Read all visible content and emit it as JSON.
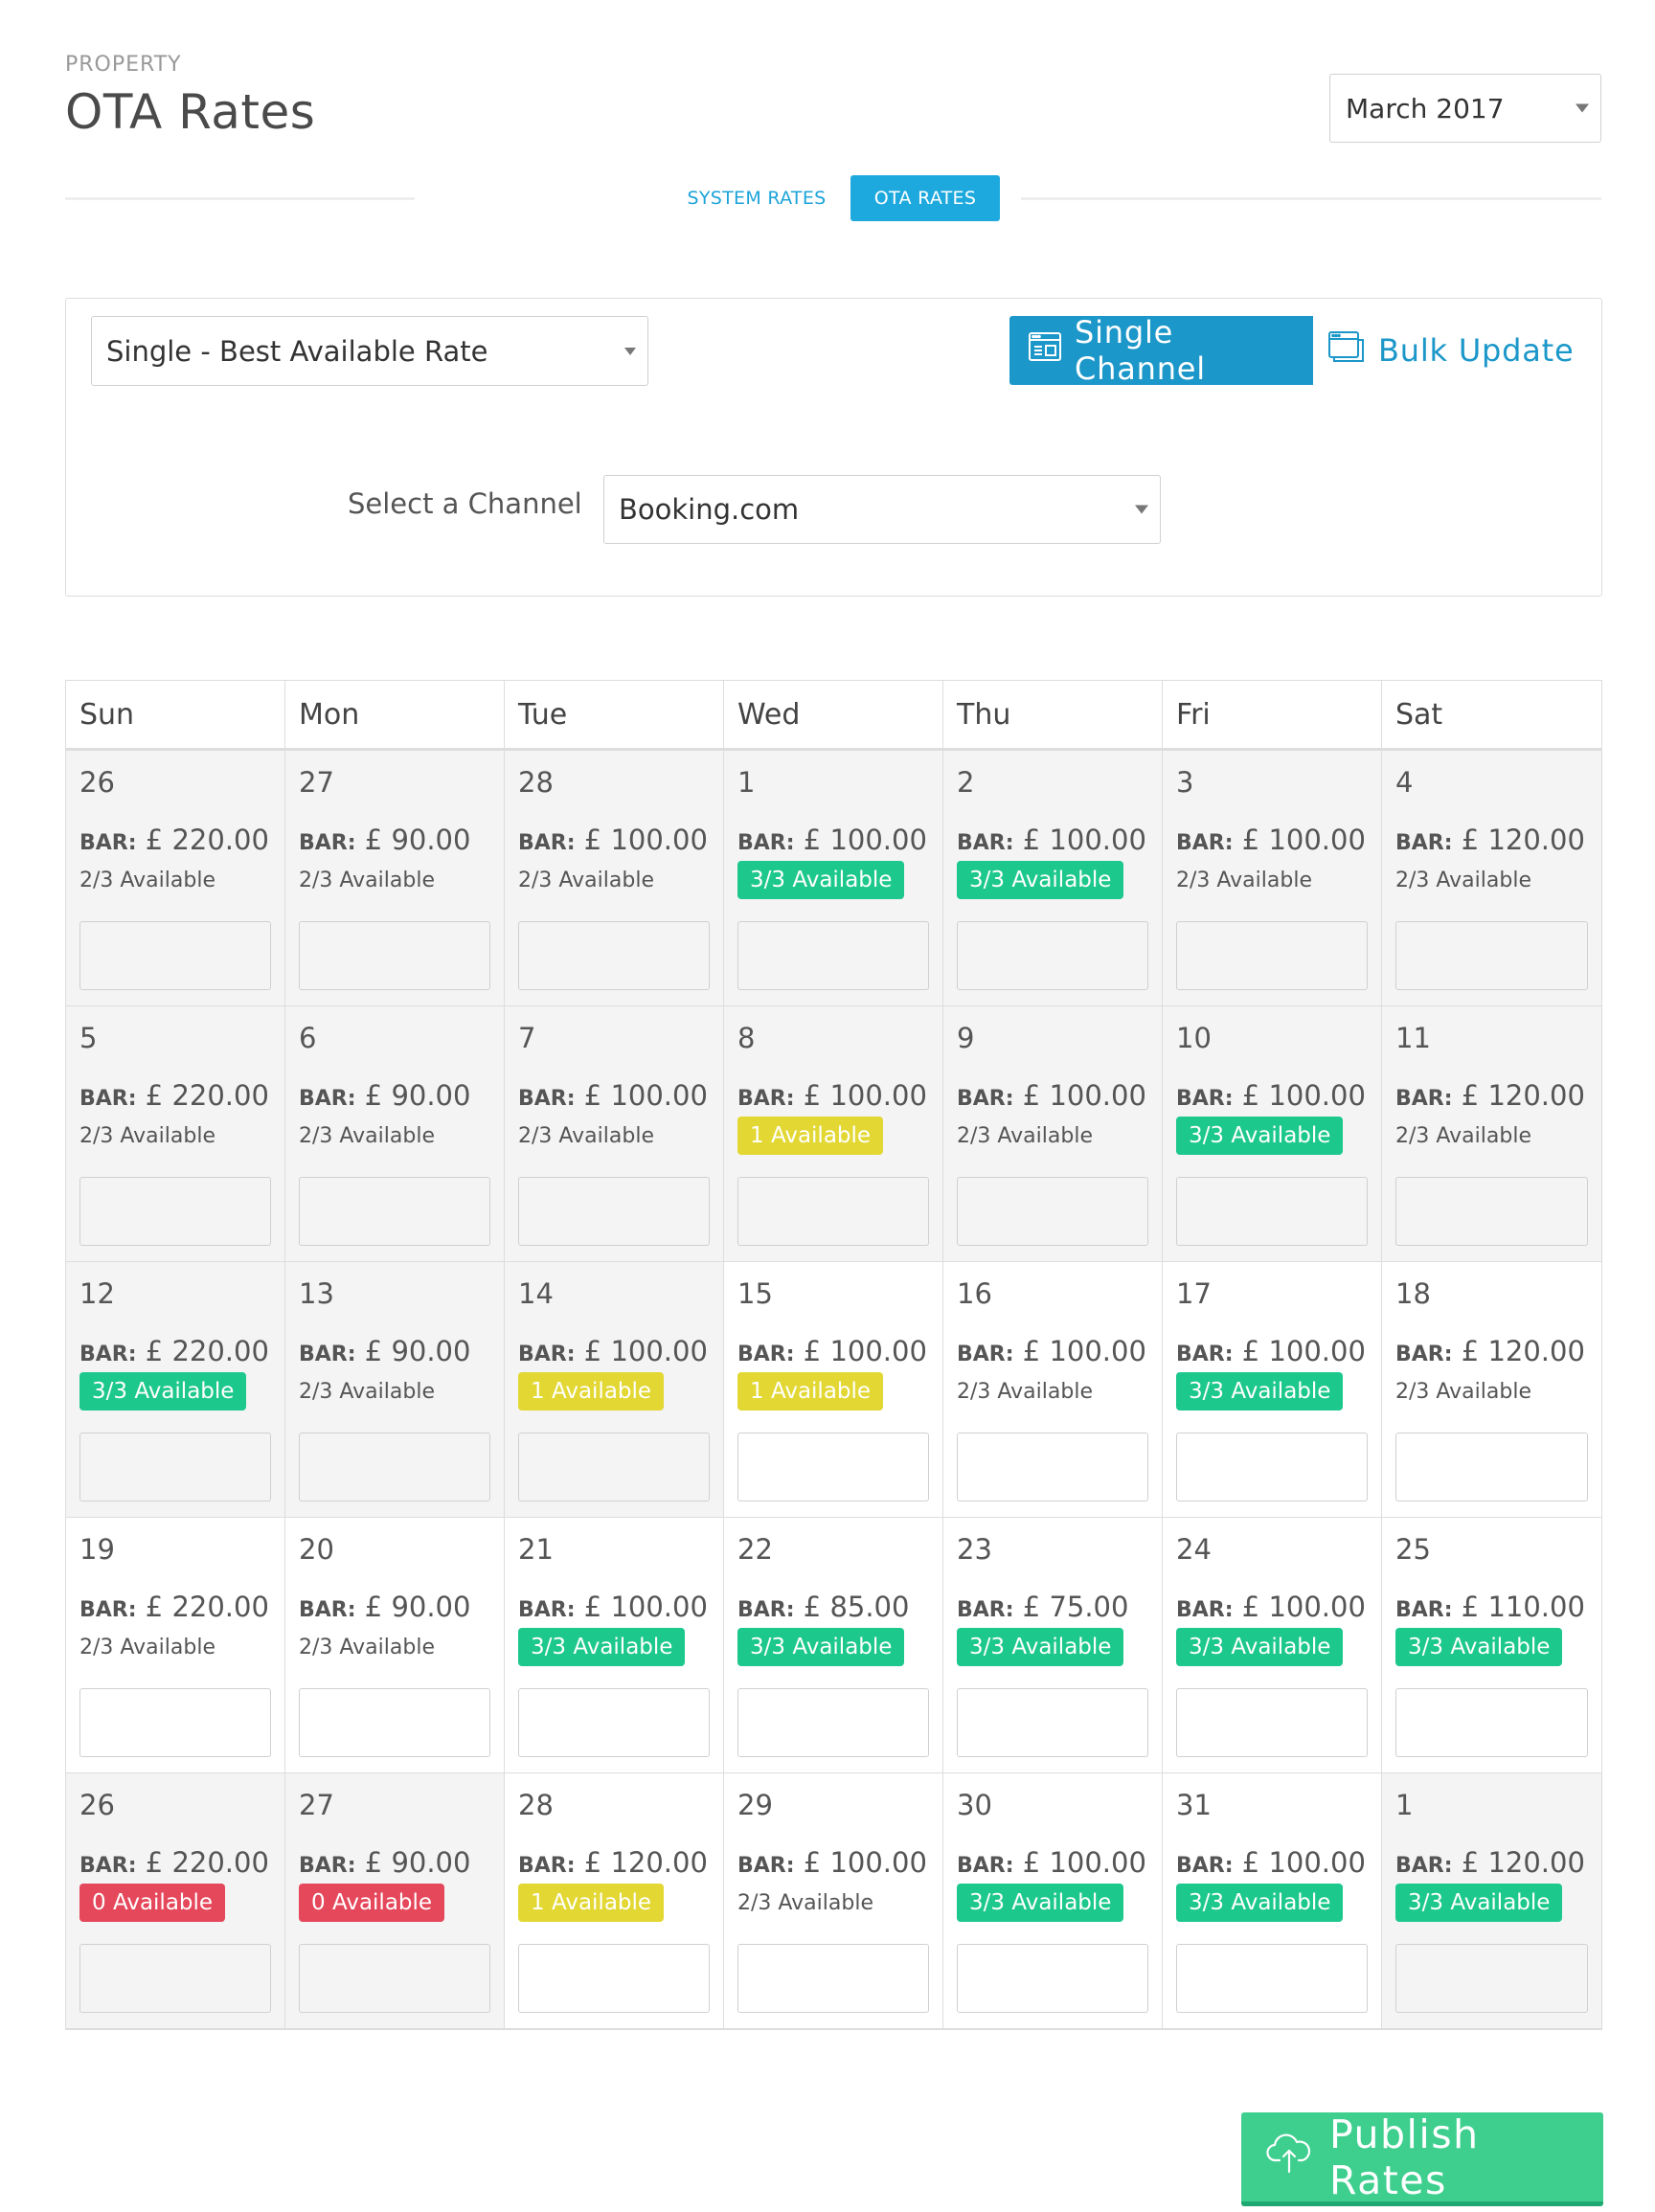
{
  "header": {
    "eyebrow": "PROPERTY",
    "title": "OTA Rates",
    "month_select": {
      "value": "March 2017",
      "icon": "chevron-down-icon"
    }
  },
  "tabs": [
    {
      "label": "SYSTEM RATES",
      "active": false
    },
    {
      "label": "OTA RATES",
      "active": true
    }
  ],
  "panel": {
    "rate_select": {
      "value": "Single - Best Available Rate"
    },
    "mode_buttons": [
      {
        "label": "Single Channel",
        "icon": "single-window-icon",
        "active": true
      },
      {
        "label": "Bulk Update",
        "icon": "stacked-windows-icon",
        "active": false
      }
    ],
    "channel_label": "Select a Channel",
    "channel_select": {
      "value": "Booking.com"
    }
  },
  "calendar": {
    "bar_label": "BAR:",
    "currency": "£",
    "weekdays": [
      "Sun",
      "Mon",
      "Tue",
      "Wed",
      "Thu",
      "Fri",
      "Sat"
    ],
    "days": [
      {
        "day": "26",
        "rate": "220.00",
        "availability": "2/3 Available",
        "status": "plain",
        "past": true
      },
      {
        "day": "27",
        "rate": "90.00",
        "availability": "2/3 Available",
        "status": "plain",
        "past": true
      },
      {
        "day": "28",
        "rate": "100.00",
        "availability": "2/3 Available",
        "status": "plain",
        "past": true
      },
      {
        "day": "1",
        "rate": "100.00",
        "availability": "3/3 Available",
        "status": "green",
        "past": true
      },
      {
        "day": "2",
        "rate": "100.00",
        "availability": "3/3 Available",
        "status": "green",
        "past": true
      },
      {
        "day": "3",
        "rate": "100.00",
        "availability": "2/3 Available",
        "status": "plain",
        "past": true
      },
      {
        "day": "4",
        "rate": "120.00",
        "availability": "2/3 Available",
        "status": "plain",
        "past": true
      },
      {
        "day": "5",
        "rate": "220.00",
        "availability": "2/3 Available",
        "status": "plain",
        "past": true
      },
      {
        "day": "6",
        "rate": "90.00",
        "availability": "2/3 Available",
        "status": "plain",
        "past": true
      },
      {
        "day": "7",
        "rate": "100.00",
        "availability": "2/3 Available",
        "status": "plain",
        "past": true
      },
      {
        "day": "8",
        "rate": "100.00",
        "availability": "1 Available",
        "status": "yellow",
        "past": true
      },
      {
        "day": "9",
        "rate": "100.00",
        "availability": "2/3 Available",
        "status": "plain",
        "past": true
      },
      {
        "day": "10",
        "rate": "100.00",
        "availability": "3/3 Available",
        "status": "green",
        "past": true
      },
      {
        "day": "11",
        "rate": "120.00",
        "availability": "2/3 Available",
        "status": "plain",
        "past": true
      },
      {
        "day": "12",
        "rate": "220.00",
        "availability": "3/3 Available",
        "status": "green",
        "past": true
      },
      {
        "day": "13",
        "rate": "90.00",
        "availability": "2/3 Available",
        "status": "plain",
        "past": true
      },
      {
        "day": "14",
        "rate": "100.00",
        "availability": "1 Available",
        "status": "yellow",
        "past": true
      },
      {
        "day": "15",
        "rate": "100.00",
        "availability": "1 Available",
        "status": "yellow",
        "past": false
      },
      {
        "day": "16",
        "rate": "100.00",
        "availability": "2/3 Available",
        "status": "plain",
        "past": false
      },
      {
        "day": "17",
        "rate": "100.00",
        "availability": "3/3 Available",
        "status": "green",
        "past": false
      },
      {
        "day": "18",
        "rate": "120.00",
        "availability": "2/3 Available",
        "status": "plain",
        "past": false
      },
      {
        "day": "19",
        "rate": "220.00",
        "availability": "2/3 Available",
        "status": "plain",
        "past": false
      },
      {
        "day": "20",
        "rate": "90.00",
        "availability": "2/3 Available",
        "status": "plain",
        "past": false
      },
      {
        "day": "21",
        "rate": "100.00",
        "availability": "3/3 Available",
        "status": "green",
        "past": false
      },
      {
        "day": "22",
        "rate": "85.00",
        "availability": "3/3 Available",
        "status": "green",
        "past": false
      },
      {
        "day": "23",
        "rate": "75.00",
        "availability": "3/3 Available",
        "status": "green",
        "past": false
      },
      {
        "day": "24",
        "rate": "100.00",
        "availability": "3/3 Available",
        "status": "green",
        "past": false
      },
      {
        "day": "25",
        "rate": "110.00",
        "availability": "3/3 Available",
        "status": "green",
        "past": false
      },
      {
        "day": "26",
        "rate": "220.00",
        "availability": "0 Available",
        "status": "red",
        "past": true
      },
      {
        "day": "27",
        "rate": "90.00",
        "availability": "0 Available",
        "status": "red",
        "past": true
      },
      {
        "day": "28",
        "rate": "120.00",
        "availability": "1 Available",
        "status": "yellow",
        "past": false
      },
      {
        "day": "29",
        "rate": "100.00",
        "availability": "2/3 Available",
        "status": "plain",
        "past": false
      },
      {
        "day": "30",
        "rate": "100.00",
        "availability": "3/3 Available",
        "status": "green",
        "past": false
      },
      {
        "day": "31",
        "rate": "100.00",
        "availability": "3/3 Available",
        "status": "green",
        "past": false
      },
      {
        "day": "1",
        "rate": "120.00",
        "availability": "3/3 Available",
        "status": "green",
        "past": true
      }
    ]
  },
  "colors": {
    "accent": "#1ea9de",
    "green": "#1dc88d",
    "yellow": "#e2d733",
    "red": "#e5475b",
    "publish": "#3ecf8e",
    "past_cell": "#f4f4f4"
  },
  "footer": {
    "publish_label": "Publish Rates",
    "publish_icon": "cloud-upload-icon"
  }
}
